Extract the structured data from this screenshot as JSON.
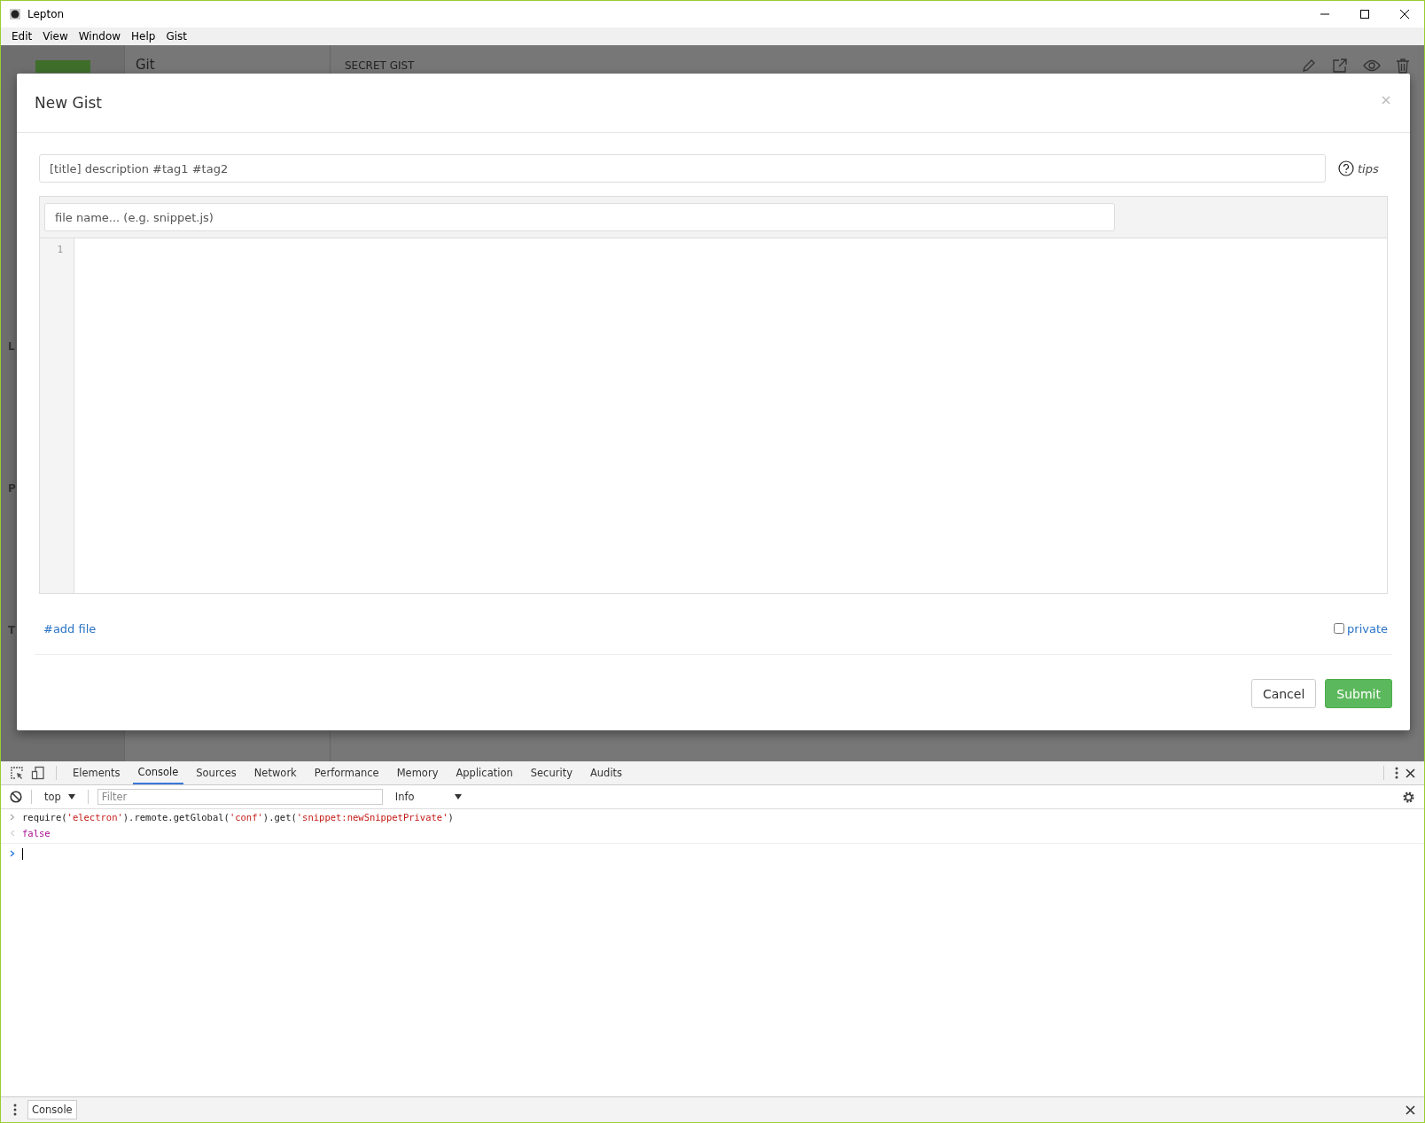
{
  "window": {
    "title": "Lepton"
  },
  "menu": [
    "Edit",
    "View",
    "Window",
    "Help",
    "Gist"
  ],
  "background": {
    "sidebar_fragments": [
      "L",
      "P",
      "T"
    ],
    "list_title": "Git",
    "header_label": "SECRET GIST"
  },
  "modal": {
    "title": "New Gist",
    "description": {
      "placeholder": "[title] description #tag1 #tag2"
    },
    "tips": "tips",
    "file": {
      "placeholder": "file name... (e.g. snippet.js)",
      "line_numbers": [
        "1"
      ]
    },
    "add_file": "#add file",
    "private": {
      "label": "private",
      "checked": false
    },
    "buttons": [
      "Cancel",
      "Submit"
    ]
  },
  "devtools": {
    "tabs": [
      {
        "label": "Elements",
        "selected": false
      },
      {
        "label": "Console",
        "selected": true
      },
      {
        "label": "Sources",
        "selected": false
      },
      {
        "label": "Network",
        "selected": false
      },
      {
        "label": "Performance",
        "selected": false
      },
      {
        "label": "Memory",
        "selected": false
      },
      {
        "label": "Application",
        "selected": false
      },
      {
        "label": "Security",
        "selected": false
      },
      {
        "label": "Audits",
        "selected": false
      }
    ],
    "context": "top",
    "filter": {
      "placeholder": "Filter"
    },
    "level": "Info",
    "console": [
      {
        "kind": "input",
        "parts": [
          {
            "kind": "code",
            "text": "require("
          },
          {
            "kind": "string",
            "text": "'electron'"
          },
          {
            "kind": "code",
            "text": ").remote.getGlobal("
          },
          {
            "kind": "string",
            "text": "'conf'"
          },
          {
            "kind": "code",
            "text": ").get("
          },
          {
            "kind": "string",
            "text": "'snippet:newSnippetPrivate'"
          },
          {
            "kind": "code",
            "text": ")"
          }
        ]
      },
      {
        "kind": "output",
        "parts": [
          {
            "kind": "keyword",
            "text": "false"
          }
        ]
      }
    ],
    "drawer_tab": "Console"
  }
}
